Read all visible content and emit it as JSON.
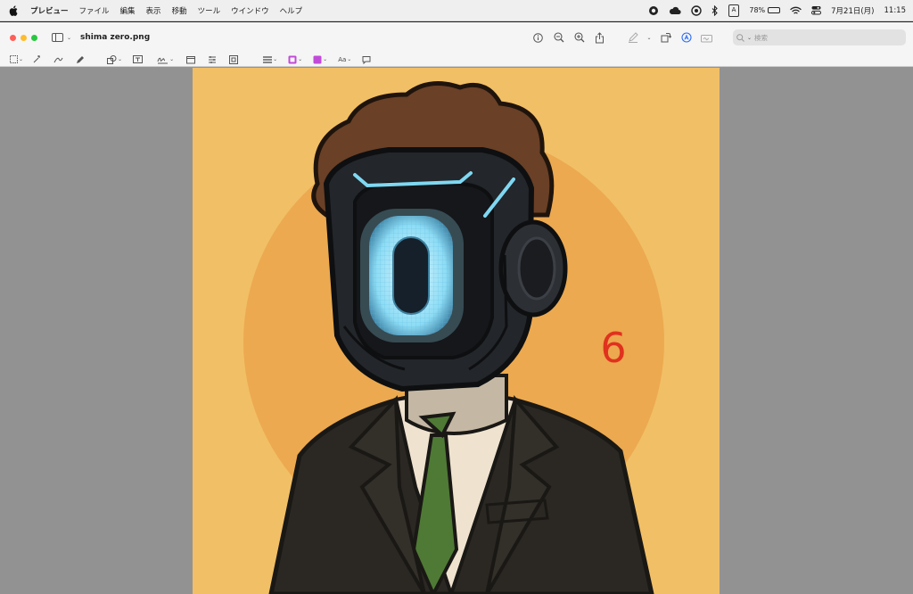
{
  "menubar": {
    "app_name": "プレビュー",
    "items": [
      "ファイル",
      "編集",
      "表示",
      "移動",
      "ツール",
      "ウインドウ",
      "ヘルプ"
    ],
    "input_mode": "A",
    "battery_percent": "78%",
    "date": "7月21日(月)",
    "time": "11:15"
  },
  "window": {
    "title": "shima zero.png",
    "search": {
      "placeholder": "検索",
      "value": ""
    }
  },
  "markup": {
    "text_style_label": "Aa"
  },
  "image": {
    "face_glyph": "0",
    "number_label": "6",
    "colors": {
      "background": "#f1bf66",
      "halo": "#eca94f",
      "number": "#e0321e",
      "visor_glow": "#9fe6ff",
      "suit": "#2b2823",
      "tie": "#4f7a35",
      "hair": "#6a4026"
    }
  }
}
